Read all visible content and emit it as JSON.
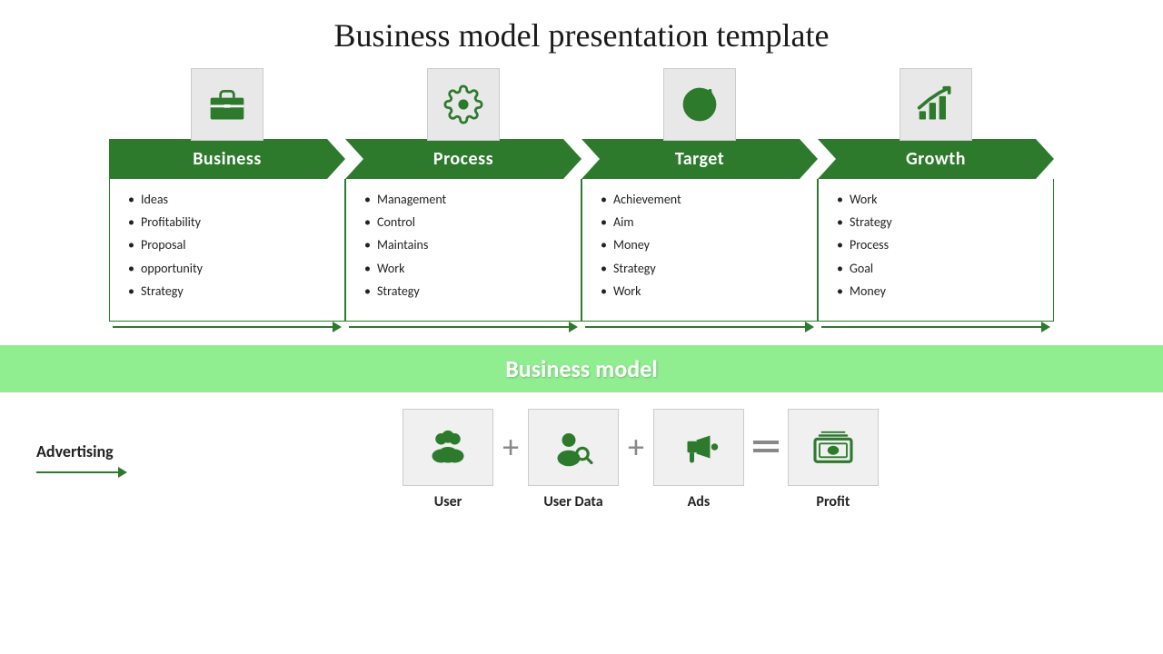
{
  "title": "Business model presentation template",
  "cards": [
    {
      "id": "business",
      "label": "Business",
      "items": [
        "Ideas",
        "Profitability",
        "Proposal",
        "opportunity",
        "Strategy"
      ]
    },
    {
      "id": "process",
      "label": "Process",
      "items": [
        "Management",
        "Control",
        "Maintains",
        "Work",
        "Strategy"
      ]
    },
    {
      "id": "target",
      "label": "Target",
      "items": [
        "Achievement",
        "Aim",
        "Money",
        "Strategy",
        "Work"
      ]
    },
    {
      "id": "growth",
      "label": "Growth",
      "items": [
        "Work",
        "Strategy",
        "Process",
        "Goal",
        "Money"
      ]
    }
  ],
  "business_model_label": "Business model",
  "advertising_label": "Advertising",
  "bottom_items": [
    {
      "id": "user",
      "label": "User"
    },
    {
      "id": "user-data",
      "label": "User Data"
    },
    {
      "id": "ads",
      "label": "Ads"
    },
    {
      "id": "profit",
      "label": "Profit"
    }
  ],
  "colors": {
    "green_dark": "#2d7a2d",
    "green_light": "#90ee90",
    "icon_bg": "#e8e8e8"
  }
}
